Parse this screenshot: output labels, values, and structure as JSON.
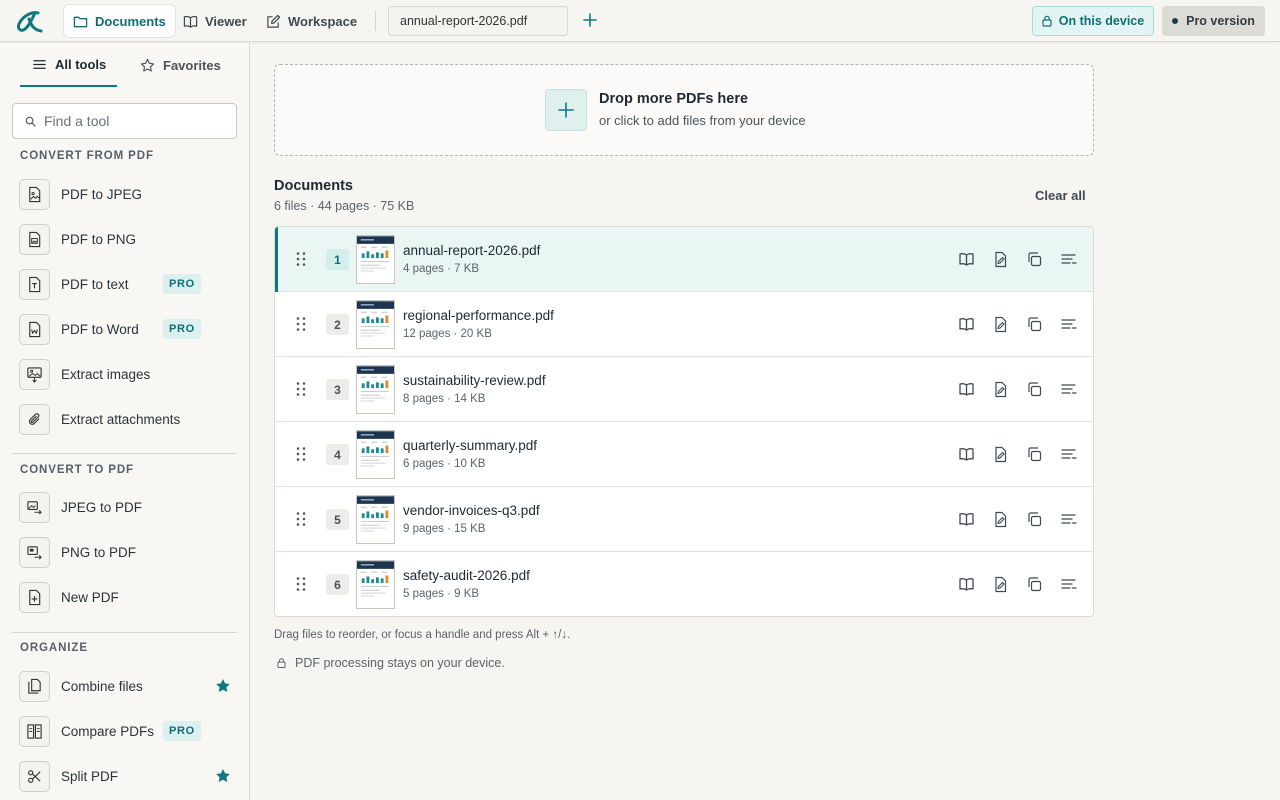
{
  "topbar": {
    "nav": [
      {
        "label": "Documents",
        "icon": "folder-icon",
        "active": true
      },
      {
        "label": "Viewer",
        "icon": "book-icon",
        "active": false
      },
      {
        "label": "Workspace",
        "icon": "edit-icon",
        "active": false
      }
    ],
    "open_file_tab": "annual-report-2026.pdf",
    "device_button": "On this device",
    "pro_button": "Pro version"
  },
  "sidebar": {
    "tabs": [
      {
        "label": "All tools",
        "icon": "menu-icon",
        "active": true
      },
      {
        "label": "Favorites",
        "icon": "star-outline-icon",
        "active": false
      }
    ],
    "search_placeholder": "Find a tool",
    "sections": [
      {
        "heading": "CONVERT FROM PDF",
        "tools": [
          {
            "label": "PDF to JPEG",
            "icon": "file-image-icon",
            "pro": false,
            "favorite": false
          },
          {
            "label": "PDF to PNG",
            "icon": "file-png-icon",
            "pro": false,
            "favorite": false
          },
          {
            "label": "PDF to text",
            "icon": "file-text-icon",
            "pro": true,
            "favorite": false
          },
          {
            "label": "PDF to Word",
            "icon": "file-word-icon",
            "pro": true,
            "favorite": false
          },
          {
            "label": "Extract images",
            "icon": "extract-image-icon",
            "pro": false,
            "favorite": false
          },
          {
            "label": "Extract attachments",
            "icon": "paperclip-icon",
            "pro": false,
            "favorite": false
          }
        ]
      },
      {
        "heading": "CONVERT TO PDF",
        "tools": [
          {
            "label": "JPEG to PDF",
            "icon": "image-to-pdf-icon",
            "pro": false,
            "favorite": false
          },
          {
            "label": "PNG to PDF",
            "icon": "png-to-pdf-icon",
            "pro": false,
            "favorite": false
          },
          {
            "label": "New PDF",
            "icon": "file-plus-icon",
            "pro": false,
            "favorite": false
          }
        ]
      },
      {
        "heading": "ORGANIZE",
        "tools": [
          {
            "label": "Combine files",
            "icon": "combine-icon",
            "pro": false,
            "favorite": true
          },
          {
            "label": "Compare PDFs",
            "icon": "compare-icon",
            "pro": true,
            "favorite": false
          },
          {
            "label": "Split PDF",
            "icon": "scissors-icon",
            "pro": false,
            "favorite": true
          }
        ]
      }
    ],
    "pro_badge": "PRO"
  },
  "dropzone": {
    "title": "Drop more PDFs here",
    "subtitle": "or click to add files from your device"
  },
  "documents": {
    "title": "Documents",
    "stats": "6 files · 44 pages · 75 KB",
    "clear_all": "Clear all",
    "items": [
      {
        "index": "1",
        "name": "annual-report-2026.pdf",
        "meta": "4 pages · 7 KB",
        "selected": true
      },
      {
        "index": "2",
        "name": "regional-performance.pdf",
        "meta": "12 pages · 20 KB",
        "selected": false
      },
      {
        "index": "3",
        "name": "sustainability-review.pdf",
        "meta": "8 pages · 14 KB",
        "selected": false
      },
      {
        "index": "4",
        "name": "quarterly-summary.pdf",
        "meta": "6 pages · 10 KB",
        "selected": false
      },
      {
        "index": "5",
        "name": "vendor-invoices-q3.pdf",
        "meta": "9 pages · 15 KB",
        "selected": false
      },
      {
        "index": "6",
        "name": "safety-audit-2026.pdf",
        "meta": "5 pages · 9 KB",
        "selected": false
      }
    ],
    "row_actions": [
      "open-in-viewer-icon",
      "edit-file-icon",
      "duplicate-icon",
      "more-options-icon"
    ]
  },
  "footer": {
    "hint": "Drag files to reorder, or focus a handle and press Alt + ↑/↓.",
    "privacy": "PDF processing stays on your device."
  },
  "colors": {
    "accent": "#0f7a7e",
    "accent_light": "#e2f4f3",
    "selected_row": "#eaf6f4",
    "background": "#f6f5f2"
  }
}
